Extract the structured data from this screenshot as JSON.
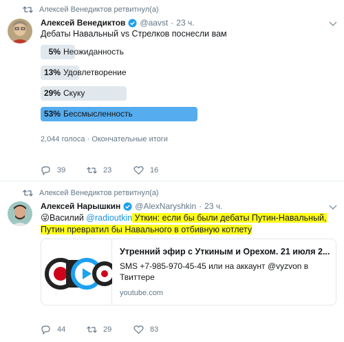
{
  "tweets": [
    {
      "retweet_text": "Алексей Венедиктов ретвитнул(а)",
      "author_name": "Алексей Венедиктов",
      "author_handle": "@aavst",
      "time": "23 ч.",
      "text": "Дебаты Навальный vs Стрелков поснесли вам",
      "poll": {
        "options": [
          {
            "pct": "5%",
            "label": "Неожиданность",
            "fraction": 0.05,
            "winner": false
          },
          {
            "pct": "13%",
            "label": "Удовлетворение",
            "fraction": 0.13,
            "winner": false
          },
          {
            "pct": "29%",
            "label": "Скуку",
            "fraction": 0.29,
            "winner": false
          },
          {
            "pct": "53%",
            "label": "Бессмысленность",
            "fraction": 0.53,
            "winner": true
          }
        ],
        "votes": "2,044 голоса",
        "status": "Окончательные итоги"
      },
      "replies": "39",
      "retweets": "23",
      "likes": "16"
    },
    {
      "retweet_text": "Алексей Венедиктов ретвитнул(а)",
      "author_name": "Алексей Нарышкин",
      "author_handle": "@AlexNaryshkin",
      "time": "23 ч.",
      "text_emoji": "😜",
      "text_prefix": "Василий ",
      "text_mention": "@radioutkin",
      "text_highlight_1": " Уткин: если бы были дебаты Путин-Навальный,",
      "text_highlight_2": "Путин превратил бы Навального в отбивную котлету",
      "card": {
        "title": "Утренний эфир с Уткиным и Орехом. 21 июля 2...",
        "description": "SMS +7-985-970-45-45 или на аккаунт @vyzvon в Твиттере",
        "domain": "youtube.com"
      },
      "replies": "44",
      "retweets": "29",
      "likes": "83"
    }
  ],
  "colors": {
    "accent": "#1da1f2",
    "poll_winner": "#55acee",
    "poll_bar": "#e1e8ed",
    "highlight": "#ffff1a",
    "muted": "#657786"
  }
}
